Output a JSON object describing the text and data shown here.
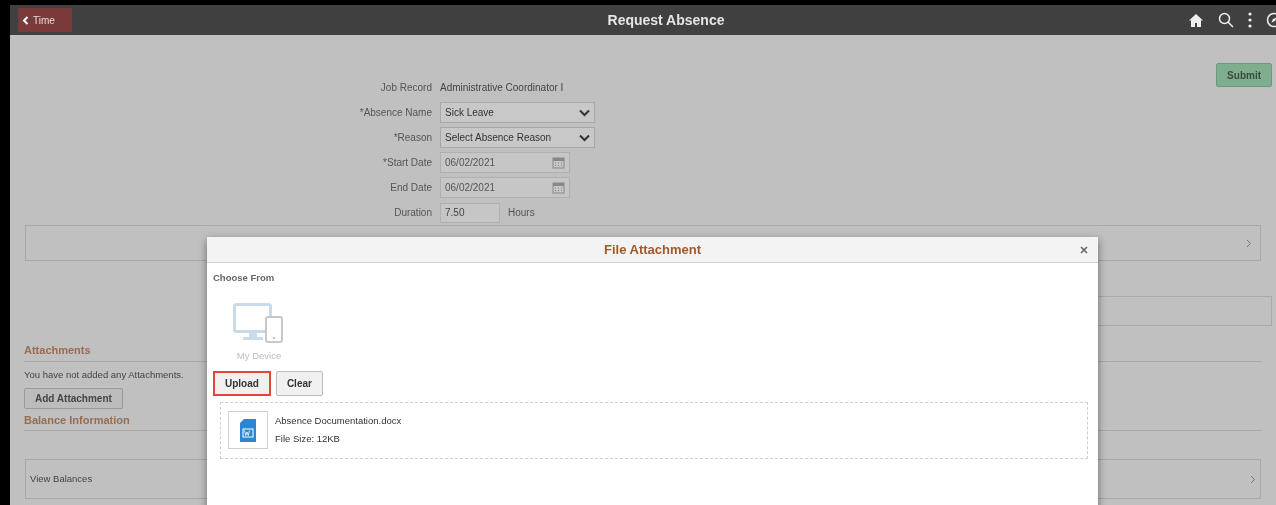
{
  "header": {
    "back_button": "Time",
    "title": "Request Absence"
  },
  "submit_button": "Submit",
  "form": [
    {
      "kind": "text",
      "label": "Job Record",
      "value": "Administrative Coordinator I"
    },
    {
      "kind": "select",
      "label": "*Absence Name",
      "value": "Sick Leave"
    },
    {
      "kind": "select",
      "label": "*Reason",
      "value": "Select Absence Reason"
    },
    {
      "kind": "date",
      "label": "*Start Date",
      "value": "06/02/2021"
    },
    {
      "kind": "date",
      "label": "End Date",
      "value": "06/02/2021"
    },
    {
      "kind": "duration",
      "label": "Duration",
      "value": "7.50",
      "unit": "Hours"
    }
  ],
  "attachments": {
    "heading": "Attachments",
    "message": "You have not added any Attachments.",
    "button": "Add Attachment"
  },
  "balance": {
    "heading": "Balance Information",
    "row": "View Balances"
  },
  "modal": {
    "title": "File Attachment",
    "choose_from": "Choose From",
    "source": "My Device",
    "buttons": [
      {
        "label": "Upload",
        "highlighted": true
      },
      {
        "label": "Clear",
        "highlighted": false
      }
    ],
    "file": {
      "name": "Absence Documentation.docx",
      "size": "File Size: 12KB"
    }
  }
}
